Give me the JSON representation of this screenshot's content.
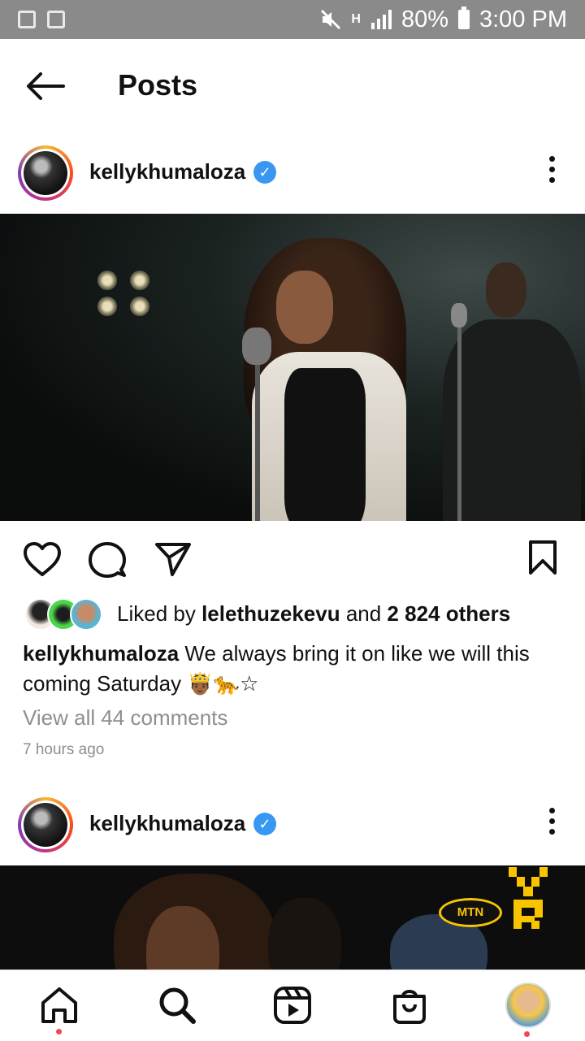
{
  "status_bar": {
    "signal_label": "H",
    "battery_text": "80%",
    "time": "3:00 PM"
  },
  "header": {
    "title": "Posts"
  },
  "posts": [
    {
      "username": "kellykhumaloza",
      "verified": true,
      "likes": {
        "prefix": "Liked by ",
        "liker": "lelethuzekevu",
        "middle": " and ",
        "others": "2 824 others"
      },
      "caption": {
        "username": "kellykhumaloza",
        "text": " We always bring it on like we will this coming Saturday 🤴🏾🐆☆"
      },
      "comments_link": "View all 44 comments",
      "time_ago": "7 hours ago"
    },
    {
      "username": "kellykhumaloza",
      "verified": true,
      "image_text": "MTN"
    }
  ],
  "icons": {
    "back": "arrow-left-icon",
    "like": "heart-icon",
    "comment": "comment-bubble-icon",
    "share": "paper-plane-icon",
    "save": "bookmark-icon",
    "more": "more-vertical-icon",
    "nav": [
      "home-icon",
      "search-icon",
      "reels-icon",
      "shop-icon",
      "profile-avatar"
    ]
  },
  "colors": {
    "verified_blue": "#3897f0",
    "notification_dot": "#ed4956",
    "status_bar": "#8a8a8a",
    "secondary_text": "#8e8e8e"
  }
}
